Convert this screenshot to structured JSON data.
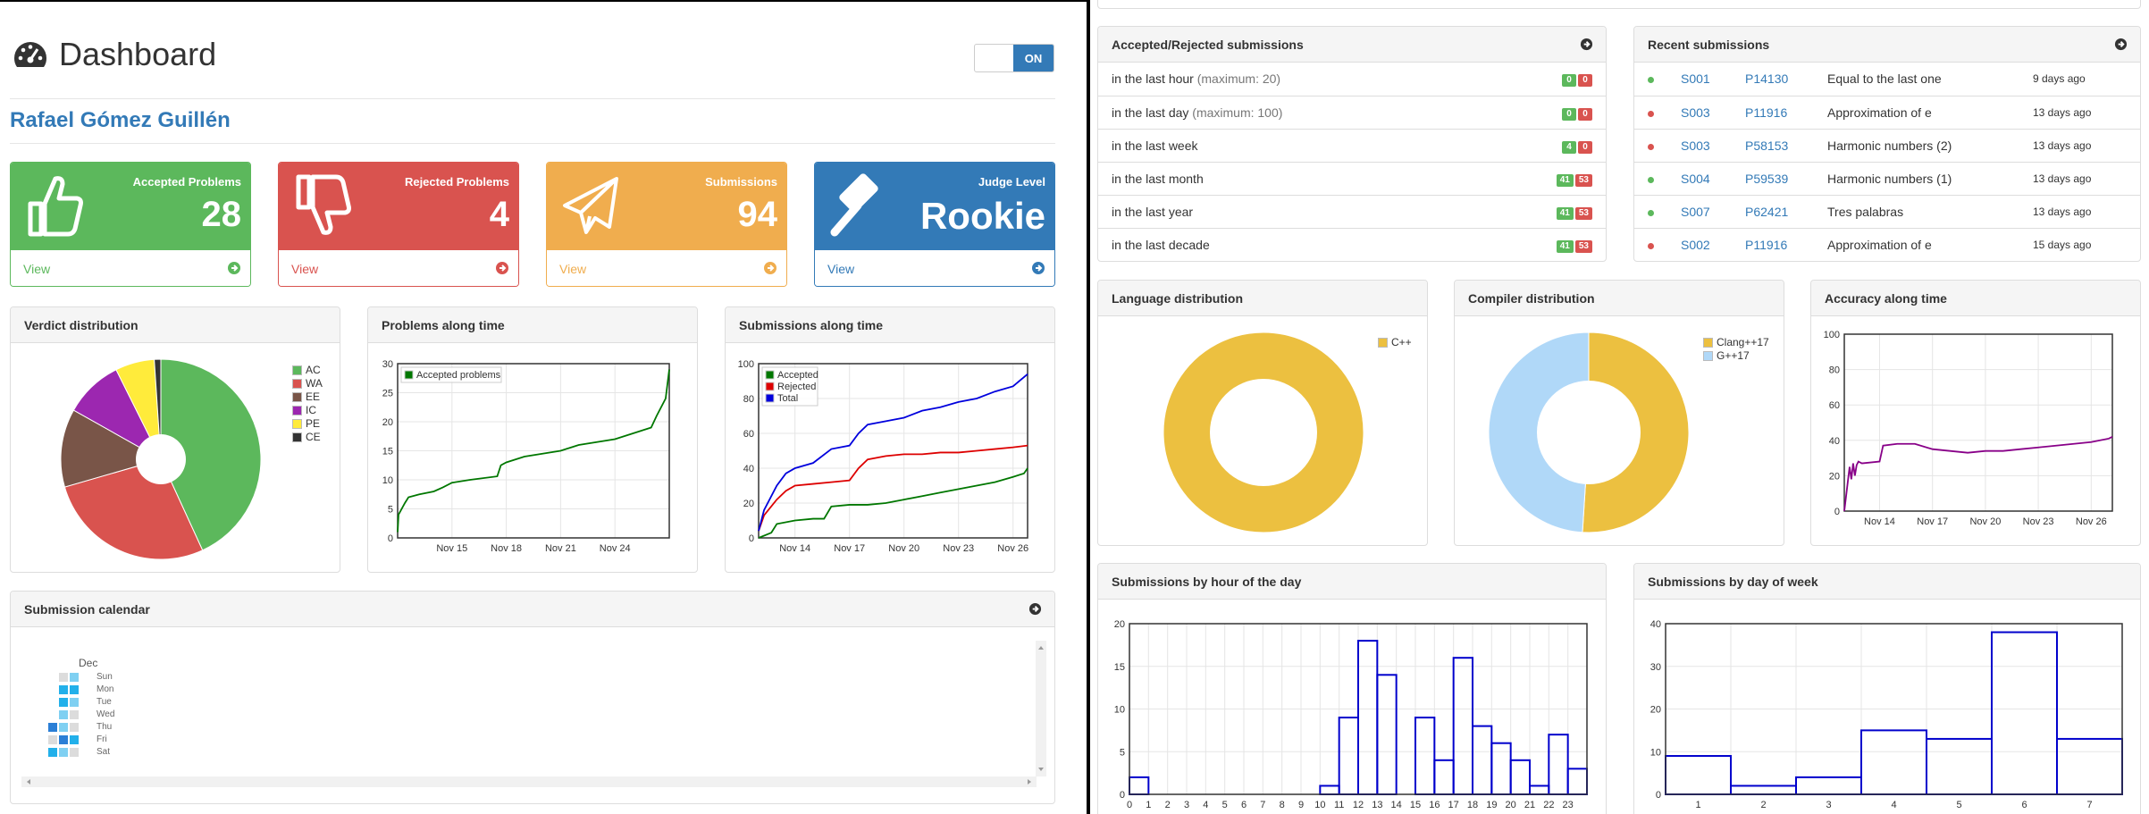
{
  "header": {
    "title": "Dashboard",
    "toggle_label": "ON",
    "user_name": "Rafael Gómez Guillén"
  },
  "tiles": [
    {
      "label": "Accepted Problems",
      "value": "28",
      "link": "View",
      "color": "#5cb85c",
      "icon": "thumbs-up-icon"
    },
    {
      "label": "Rejected Problems",
      "value": "4",
      "link": "View",
      "color": "#d9534f",
      "icon": "thumbs-down-icon"
    },
    {
      "label": "Submissions",
      "value": "94",
      "link": "View",
      "color": "#f0ad4e",
      "icon": "paper-plane-icon"
    },
    {
      "label": "Judge Level",
      "value": "Rookie",
      "link": "View",
      "color": "#337ab7",
      "icon": "gavel-icon"
    }
  ],
  "panels": {
    "verdict": "Verdict distribution",
    "problems_time": "Problems along time",
    "submissions_time": "Submissions along time",
    "calendar": "Submission calendar",
    "accepted_rejected": "Accepted/Rejected submissions",
    "recent": "Recent submissions",
    "language": "Language distribution",
    "compiler": "Compiler distribution",
    "accuracy": "Accuracy along time",
    "by_hour": "Submissions by hour of the day",
    "by_day": "Submissions by day of week"
  },
  "acc_rej_rows": [
    {
      "label": "in the last hour",
      "note": "(maximum: 20)",
      "acc": "0",
      "rej": "0"
    },
    {
      "label": "in the last day",
      "note": "(maximum: 100)",
      "acc": "0",
      "rej": "0"
    },
    {
      "label": "in the last week",
      "note": "",
      "acc": "4",
      "rej": "0"
    },
    {
      "label": "in the last month",
      "note": "",
      "acc": "41",
      "rej": "53"
    },
    {
      "label": "in the last year",
      "note": "",
      "acc": "41",
      "rej": "53"
    },
    {
      "label": "in the last decade",
      "note": "",
      "acc": "41",
      "rej": "53"
    }
  ],
  "recent_rows": [
    {
      "status": "#5cb85c",
      "sub": "S001",
      "prob": "P14130",
      "title": "Equal to the last one",
      "when": "9 days ago"
    },
    {
      "status": "#d9534f",
      "sub": "S003",
      "prob": "P11916",
      "title": "Approximation of e",
      "when": "13 days ago"
    },
    {
      "status": "#d9534f",
      "sub": "S003",
      "prob": "P58153",
      "title": "Harmonic numbers (2)",
      "when": "13 days ago"
    },
    {
      "status": "#5cb85c",
      "sub": "S004",
      "prob": "P59539",
      "title": "Harmonic numbers (1)",
      "when": "13 days ago"
    },
    {
      "status": "#5cb85c",
      "sub": "S007",
      "prob": "P62421",
      "title": "Tres palabras",
      "when": "13 days ago"
    },
    {
      "status": "#d9534f",
      "sub": "S002",
      "prob": "P11916",
      "title": "Approximation of e",
      "when": "15 days ago"
    }
  ],
  "calendar": {
    "month": "Dec",
    "days": [
      "Sun",
      "Mon",
      "Tue",
      "Wed",
      "Thu",
      "Fri",
      "Sat"
    ]
  },
  "chart_data": [
    {
      "type": "pie",
      "title": "Verdict distribution",
      "categories": [
        "AC",
        "WA",
        "EE",
        "IC",
        "PE",
        "CE"
      ],
      "values": [
        41,
        26,
        12,
        9,
        6,
        1
      ],
      "colors": [
        "#5cb85c",
        "#d9534f",
        "#795548",
        "#9c27b0",
        "#ffeb3b",
        "#333333"
      ],
      "legend": "right"
    },
    {
      "type": "line",
      "title": "Problems along time",
      "xticks": [
        "Nov 15",
        "Nov 18",
        "Nov 21",
        "Nov 24"
      ],
      "xlim": [
        12,
        27
      ],
      "ylim": [
        0,
        30
      ],
      "yticks": [
        0,
        5,
        10,
        15,
        20,
        25,
        30
      ],
      "series": [
        {
          "name": "Accepted problems",
          "color": "#007700",
          "x": [
            12,
            12.05,
            12.4,
            12.6,
            13.2,
            14,
            14.5,
            15,
            16,
            17.5,
            17.7,
            18,
            19,
            20,
            21,
            21.5,
            22,
            23,
            24,
            25,
            26,
            26.3,
            26.8,
            27
          ],
          "y": [
            1,
            4,
            6,
            7,
            7.5,
            8,
            8.7,
            9.5,
            10,
            10.6,
            12.5,
            13,
            14,
            14.5,
            15,
            15.5,
            16,
            16.5,
            17,
            18,
            19,
            21,
            24,
            29
          ]
        }
      ],
      "legend": "top-left",
      "grid": true
    },
    {
      "type": "line",
      "title": "Submissions along time",
      "xticks": [
        "Nov 14",
        "Nov 17",
        "Nov 20",
        "Nov 23",
        "Nov 26"
      ],
      "xlim": [
        12,
        26.8
      ],
      "ylim": [
        0,
        100
      ],
      "yticks": [
        0,
        20,
        40,
        60,
        80,
        100
      ],
      "series": [
        {
          "name": "Accepted",
          "color": "#007700",
          "x": [
            12,
            12.7,
            13,
            14,
            15,
            15.6,
            16,
            17,
            18,
            19,
            20,
            21,
            22,
            23,
            24,
            25,
            26,
            26.6,
            26.8
          ],
          "y": [
            0,
            3,
            8,
            10,
            11,
            11,
            18,
            19,
            19,
            20,
            22,
            24,
            26,
            28,
            30,
            32,
            35,
            37,
            40
          ]
        },
        {
          "name": "Rejected",
          "color": "#dd0000",
          "x": [
            12,
            12.3,
            13,
            13.5,
            14,
            15,
            16,
            17,
            17.5,
            18,
            19,
            20,
            21,
            22,
            23,
            24,
            25,
            26,
            26.8
          ],
          "y": [
            4,
            13,
            22,
            27,
            30,
            31,
            32,
            33,
            40,
            45,
            47,
            48,
            48,
            49,
            49,
            50,
            51,
            52,
            53
          ]
        },
        {
          "name": "Total",
          "color": "#0000dd",
          "x": [
            12,
            12.3,
            13,
            13.5,
            14,
            15,
            16,
            17,
            17.5,
            18,
            19,
            20,
            21,
            22,
            23,
            24,
            25,
            26,
            26.8
          ],
          "y": [
            4,
            16,
            30,
            37,
            40,
            43,
            51,
            53,
            60,
            65,
            67,
            69,
            73,
            75,
            78,
            80,
            84,
            87,
            94
          ]
        }
      ],
      "legend": "top-left",
      "grid": true
    },
    {
      "type": "pie",
      "title": "Language distribution",
      "categories": [
        "C++"
      ],
      "values": [
        94
      ],
      "colors": [
        "#ecc040"
      ],
      "legend": "top-right"
    },
    {
      "type": "pie",
      "title": "Compiler distribution",
      "categories": [
        "Clang++17",
        "G++17"
      ],
      "values": [
        51,
        49
      ],
      "colors": [
        "#ecc040",
        "#b0d8f8"
      ],
      "legend": "top-right"
    },
    {
      "type": "line",
      "title": "Accuracy along time",
      "xticks": [
        "Nov 14",
        "Nov 17",
        "Nov 20",
        "Nov 23",
        "Nov 26"
      ],
      "xlim": [
        12,
        27.2
      ],
      "ylim": [
        0,
        100
      ],
      "yticks": [
        0,
        20,
        40,
        60,
        80,
        100
      ],
      "series": [
        {
          "name": "",
          "color": "#880088",
          "x": [
            12,
            12.3,
            12.4,
            12.5,
            12.6,
            12.7,
            12.8,
            13,
            14,
            14.2,
            15,
            16,
            17,
            18,
            19,
            20,
            21,
            22,
            23,
            24,
            25,
            26,
            27,
            27.2
          ],
          "y": [
            0,
            25,
            18,
            27,
            20,
            26,
            28,
            27,
            28,
            37,
            38,
            38,
            35,
            34,
            33,
            34,
            34,
            35,
            36,
            37,
            38,
            39,
            41,
            42
          ]
        }
      ],
      "grid": true
    },
    {
      "type": "bar",
      "title": "Submissions by hour of the day",
      "categories": [
        "0",
        "1",
        "2",
        "3",
        "4",
        "5",
        "6",
        "7",
        "8",
        "9",
        "10",
        "11",
        "12",
        "13",
        "14",
        "15",
        "16",
        "17",
        "18",
        "19",
        "20",
        "21",
        "22",
        "23"
      ],
      "values": [
        2,
        0,
        0,
        0,
        0,
        0,
        0,
        0,
        0,
        0,
        1,
        9,
        18,
        14,
        0,
        9,
        4,
        16,
        8,
        6,
        4,
        1,
        7,
        3
      ],
      "ylim": [
        0,
        20
      ],
      "yticks": [
        0,
        5,
        10,
        15,
        20
      ],
      "color": "#0000cc",
      "grid": true
    },
    {
      "type": "bar",
      "title": "Submissions by day of week",
      "categories": [
        "1",
        "2",
        "3",
        "4",
        "5",
        "6",
        "7"
      ],
      "values": [
        9,
        2,
        4,
        15,
        13,
        38,
        13
      ],
      "ylim": [
        0,
        40
      ],
      "yticks": [
        0,
        10,
        20,
        30,
        40
      ],
      "color": "#0000cc",
      "grid": true
    }
  ]
}
